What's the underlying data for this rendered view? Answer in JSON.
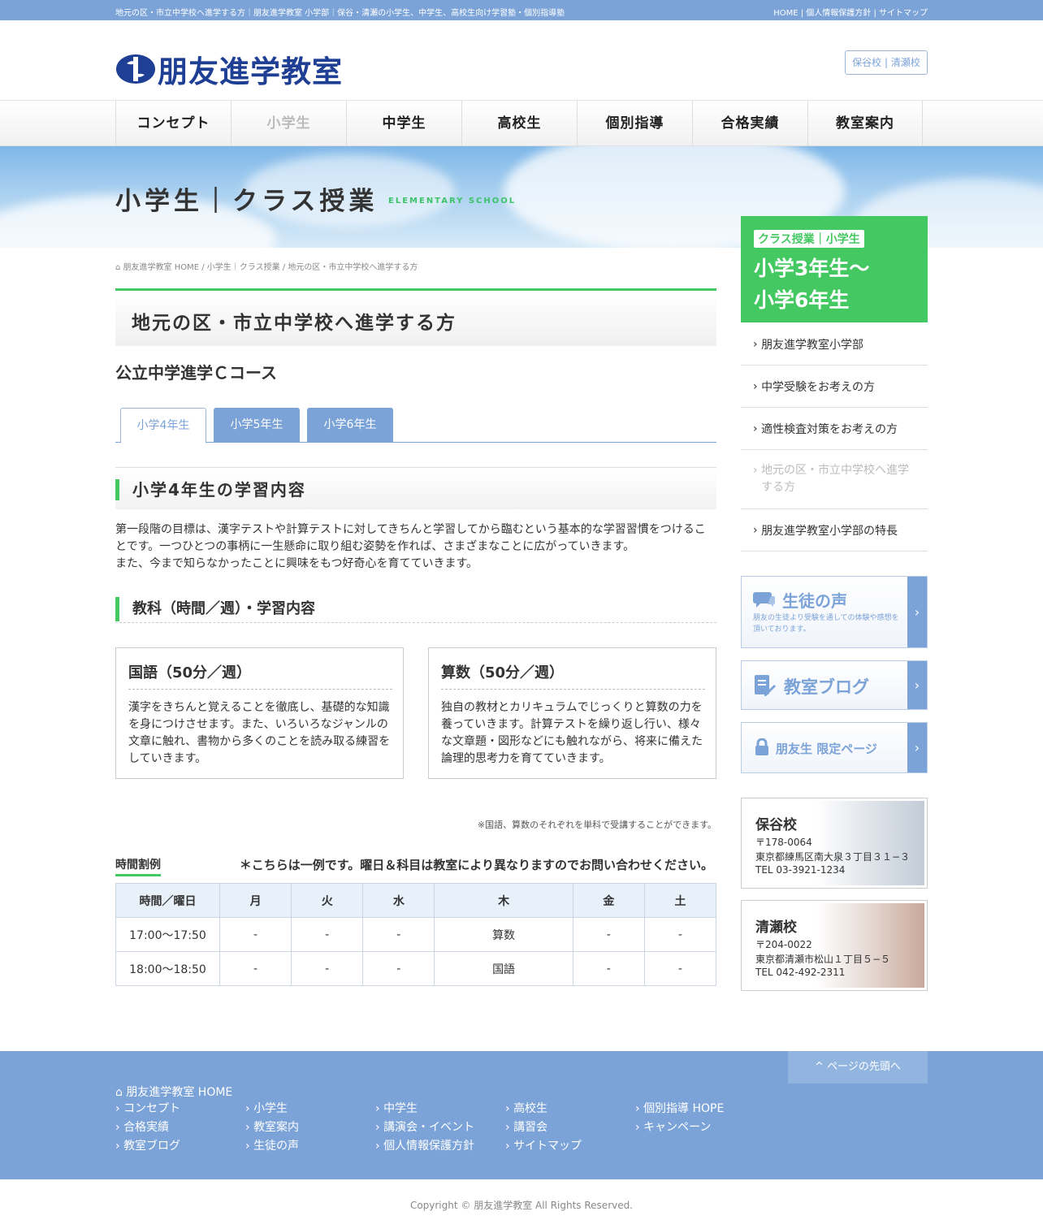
{
  "topbar": {
    "left": "地元の区・市立中学校へ進学する方｜朋友進学教室 小学部｜保谷・清瀬の小学生、中学生、高校生向け学習塾・個別指導塾",
    "right": "HOME | 個人情報保護方針 | サイトマップ"
  },
  "logo": {
    "text": "朋友進学教室"
  },
  "schools_button": "保谷校 | 清瀬校",
  "nav": [
    "コンセプト",
    "小学生",
    "中学生",
    "高校生",
    "個別指導",
    "合格実績",
    "教室案内"
  ],
  "hero": {
    "title": "小学生｜クラス授業",
    "en": "ELEMENTARY SCHOOL"
  },
  "side_top": {
    "badge": "クラス授業｜小学生",
    "line1": "小学3年生〜",
    "line2": "小学6年生"
  },
  "breadcrumb": "朋友進学教室 HOME / 小学生｜クラス授業 / 地元の区・市立中学校へ進学する方",
  "page_title": "地元の区・市立中学校へ進学する方",
  "course": "公立中学進学Ｃコース",
  "tabs": [
    "小学4年生",
    "小学5年生",
    "小学6年生"
  ],
  "section1": "小学4年生の学習内容",
  "para": [
    "第一段階の目標は、漢字テストや計算テストに対してきちんと学習してから臨むという基本的な学習習慣をつけることです。一つひとつの事柄に一生懸命に取り組む姿勢を作れば、さまざまなことに広がっていきます。",
    "また、今まで知らなかったことに興味をもつ好奇心を育てていきます。"
  ],
  "section2": "教科（時間／週）・学習内容",
  "subjects": [
    {
      "title": "国語（50分／週）",
      "text": "漢字をきちんと覚えることを徹底し、基礎的な知識を身につけさせます。また、いろいろなジャンルの文章に触れ、書物から多くのことを読み取る練習をしていきます。"
    },
    {
      "title": "算数（50分／週）",
      "text": "独自の教材とカリキュラムでじっくりと算数の力を養っていきます。計算テストを繰り返し行い、様々な文章題・図形などにも触れながら、将来に備えた論理的思考力を育てていきます。"
    }
  ],
  "note": "※国語、算数のそれぞれを単科で受講することができます。",
  "timetable": {
    "label": "時間割例",
    "note": "＊こちらは一例です。曜日＆科目は教室により異なりますのでお問い合わせください。",
    "headers": [
      "時間／曜日",
      "月",
      "火",
      "水",
      "木",
      "金",
      "土"
    ],
    "rows": [
      [
        "17:00〜17:50",
        "-",
        "-",
        "-",
        "算数",
        "-",
        "-"
      ],
      [
        "18:00〜18:50",
        "-",
        "-",
        "-",
        "国語",
        "-",
        "-"
      ]
    ]
  },
  "sidemenu": [
    "朋友進学教室小学部",
    "中学受験をお考えの方",
    "適性検査対策をお考えの方",
    "地元の区・市立中学校へ進学する方",
    "朋友進学教室小学部の特長"
  ],
  "banners": {
    "voice_title": "生徒の声",
    "voice_sub": "朋友の生徒より受験を通しての体験や感想を頂いております。",
    "blog_title": "教室ブログ",
    "limited_title": "朋友生 限定ページ"
  },
  "campuses": [
    {
      "name": "保谷校",
      "zip": "〒178-0064",
      "addr": "東京都練馬区南大泉３丁目３１−３",
      "tel": "TEL 03-3921-1234"
    },
    {
      "name": "清瀬校",
      "zip": "〒204-0022",
      "addr": "東京都清瀬市松山１丁目５−５",
      "tel": "TEL 042-492-2311"
    }
  ],
  "footer": {
    "totop": "ページの先頭へ",
    "home": "朋友進学教室 HOME",
    "cols": [
      [
        "コンセプト",
        "合格実績",
        "教室ブログ"
      ],
      [
        "小学生",
        "教室案内",
        "生徒の声"
      ],
      [
        "中学生",
        "講演会・イベント",
        "個人情報保護方針"
      ],
      [
        "高校生",
        "講習会",
        "サイトマップ"
      ],
      [
        "個別指導 HOPE",
        "キャンペーン"
      ]
    ],
    "copyright": "Copyright © 朋友進学教室 All Rights Reserved."
  },
  "colors": {
    "brand": "#1f3f95",
    "accent_blue": "#7ba3d8",
    "accent_green": "#43c862"
  }
}
